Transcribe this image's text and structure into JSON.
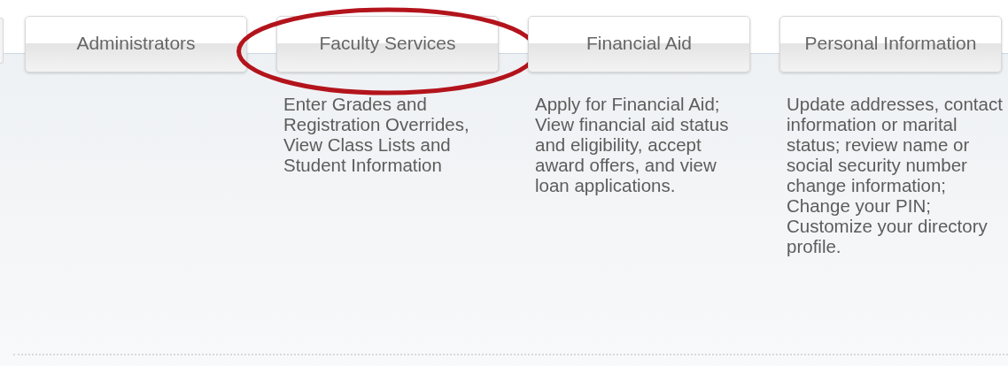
{
  "tabs": [
    {
      "label": "Administrators",
      "circled": false
    },
    {
      "label": "Faculty Services",
      "circled": true,
      "description": [
        "Enter Grades and Registration Overrides, View Class Lists and Student Information"
      ]
    },
    {
      "label": "Financial Aid",
      "circled": false,
      "description": [
        "Apply for Financial Aid;",
        "View financial aid status and eligibility, accept award offers, and view loan applications."
      ]
    },
    {
      "label": "Personal Information",
      "circled": false,
      "description": [
        "Update addresses, contact information or marital status; review name or social security number change information;",
        "Change your PIN;",
        "Customize your directory profile."
      ]
    }
  ]
}
